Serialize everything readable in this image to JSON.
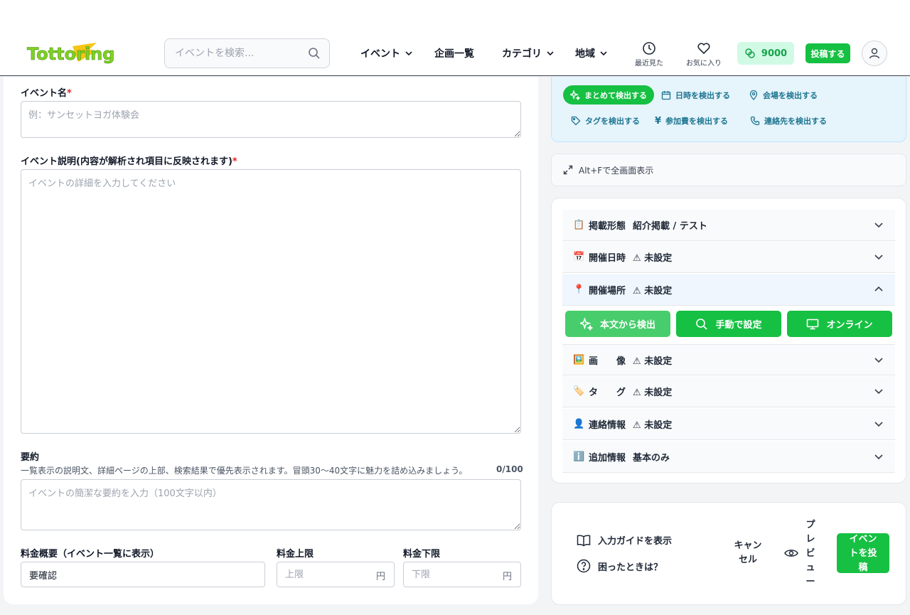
{
  "header": {
    "logo_text": "Tottoring",
    "search_placeholder": "イベントを検索...",
    "nav": {
      "event": "イベント",
      "plans": "企画一覧",
      "category": "カテゴリ",
      "region": "地域",
      "recent": "最近見た",
      "favorites": "お気に入り"
    },
    "points": "9000",
    "post_button": "投稿する"
  },
  "form": {
    "event_name_label": "イベント名",
    "event_name_placeholder": "例：サンセットヨガ体験会",
    "description_label": "イベント説明(内容が解析され項目に反映されます)",
    "description_placeholder": "イベントの詳細を入力してください",
    "summary_label": "要約",
    "summary_hint": "一覧表示の説明文、詳細ページの上部、検索結果で優先表示されます。冒頭30〜40文字に魅力を詰め込みましょう。",
    "summary_counter": "0/100",
    "summary_placeholder": "イベントの簡潔な要約を入力（100文字以内）",
    "price_summary_label": "料金概要（イベント一覧に表示）",
    "price_summary_value": "要確認",
    "price_max_label": "料金上限",
    "price_max_placeholder": "上限",
    "price_min_label": "料金下限",
    "price_min_placeholder": "下限",
    "yen": "円",
    "required_mark": "*"
  },
  "detect": {
    "all": "まとめて検出する",
    "datetime": "日時を検出する",
    "venue": "会場を検出する",
    "tags": "タグを検出する",
    "fee": "参加費を検出する",
    "contact": "連絡先を検出する"
  },
  "fullscreen_label": "Alt+Fで全画面表示",
  "sections": [
    {
      "emoji": "📋",
      "name": "掲載形態",
      "status": "紹介掲載 / テスト"
    },
    {
      "emoji": "📅",
      "name": "開催日時",
      "status": "⚠ 未設定"
    },
    {
      "emoji": "📍",
      "name": "開催場所",
      "status": "⚠ 未設定"
    },
    {
      "emoji": "🖼️",
      "name": "画　　像",
      "status": "⚠ 未設定"
    },
    {
      "emoji": "🏷️",
      "name": "タ　　グ",
      "status": "⚠ 未設定"
    },
    {
      "emoji": "👤",
      "name": "連絡情報",
      "status": "⚠ 未設定"
    },
    {
      "emoji": "ℹ️",
      "name": "追加情報",
      "status": "基本のみ"
    }
  ],
  "location_buttons": {
    "from_text": "本文から検出",
    "manual": "手動で設定",
    "online": "オンライン"
  },
  "actions": {
    "guide": "入力ガイドを表示",
    "help": "困ったときは？",
    "cancel": "キャンセル",
    "preview": "プレビュー",
    "submit": "イベントを投稿"
  },
  "colors": {
    "accent_green": "#16c043",
    "logo_green": "#7ed321",
    "logo_yellow": "#f5c518",
    "detect_blue": "#1d7590"
  }
}
